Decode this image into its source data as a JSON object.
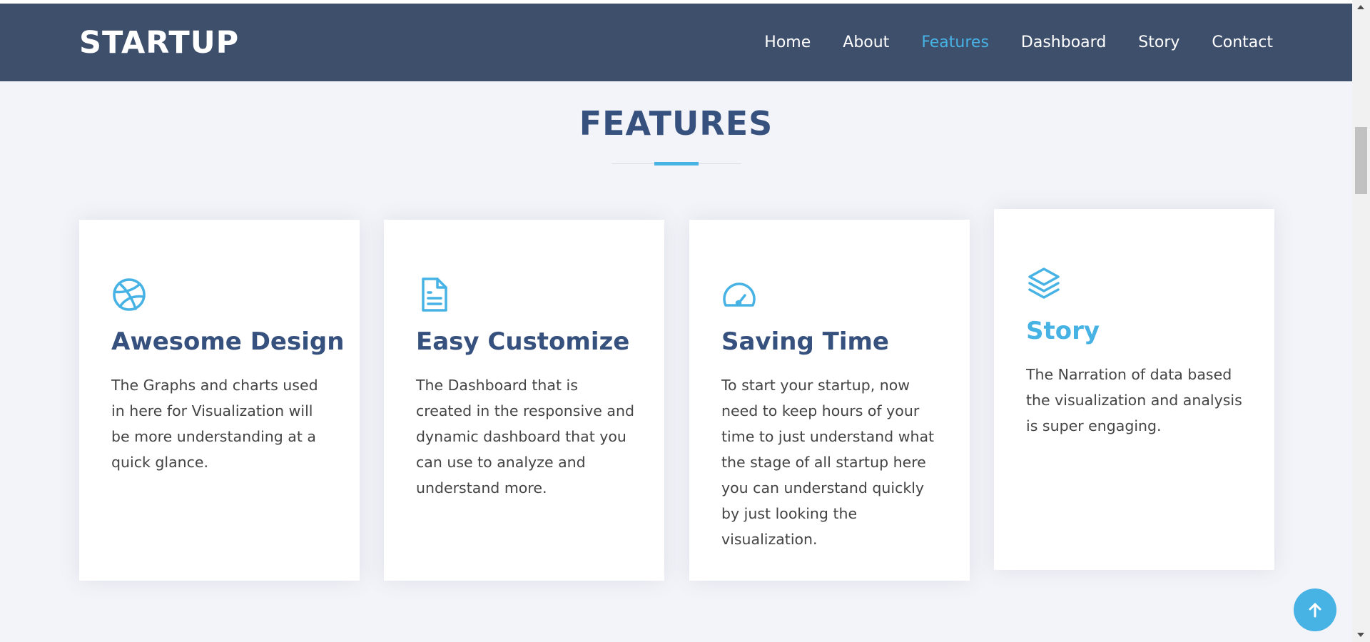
{
  "header": {
    "brand": "STARTUP",
    "nav": [
      {
        "label": "Home"
      },
      {
        "label": "About"
      },
      {
        "label": "Features",
        "active": true
      },
      {
        "label": "Dashboard"
      },
      {
        "label": "Story"
      },
      {
        "label": "Contact"
      }
    ]
  },
  "features": {
    "title": "FEATURES",
    "cards": [
      {
        "icon": "dribbble-icon",
        "title": "Awesome Design",
        "description": "The Graphs and charts used in here for Visualization will be more understanding at a quick glance."
      },
      {
        "icon": "file-text-icon",
        "title": "Easy Customize",
        "description": "The Dashboard that is created in the responsive and dynamic dashboard that you can use to analyze and understand more."
      },
      {
        "icon": "speedometer-icon",
        "title": "Saving Time",
        "description": "To start your startup, now need to keep hours of your time to just understand what the stage of all startup here you can understand quickly by just looking the visualization."
      },
      {
        "icon": "layers-icon",
        "title": "Story",
        "description": "The Narration of data based the visualization and analysis is super engaging."
      }
    ]
  },
  "colors": {
    "navbar": "#3e4f6c",
    "accent": "#47b2e4",
    "heading": "#37517e",
    "background": "#f3f4f9"
  },
  "back_to_top": {
    "icon": "arrow-up-icon"
  }
}
